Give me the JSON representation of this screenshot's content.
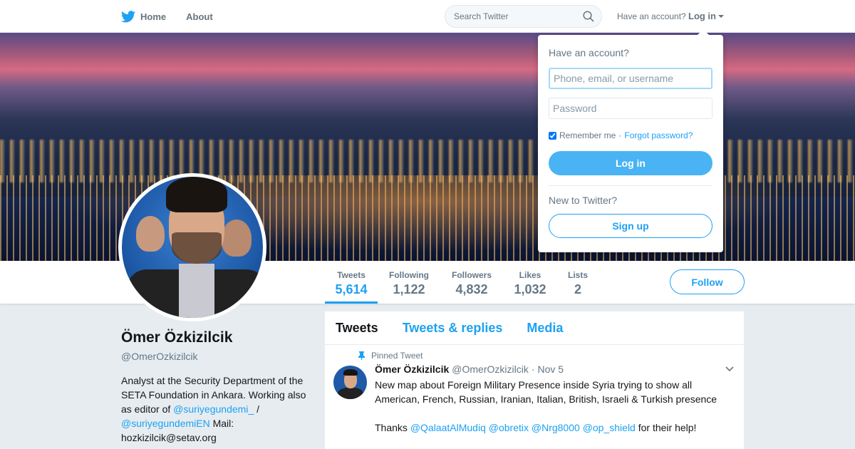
{
  "nav": {
    "home_label": "Home",
    "about_label": "About",
    "search_placeholder": "Search Twitter",
    "account_text": "Have an account?",
    "login_label": "Log in"
  },
  "stats": [
    {
      "label": "Tweets",
      "value": "5,614",
      "active": true
    },
    {
      "label": "Following",
      "value": "1,122"
    },
    {
      "label": "Followers",
      "value": "4,832"
    },
    {
      "label": "Likes",
      "value": "1,032"
    },
    {
      "label": "Lists",
      "value": "2"
    }
  ],
  "follow_label": "Follow",
  "profile": {
    "name": "Ömer Özkizilcik",
    "handle": "@OmerOzkizilcik",
    "bio_text_1": "Analyst at the Security Department of the SETA Foundation in Ankara. Working also as editor of ",
    "bio_link_1": "@suriyegundemi_",
    "bio_sep": " / ",
    "bio_link_2": "@suriyegundemiEN",
    "bio_text_2": " Mail: hozkizilcik@setav.org"
  },
  "timeline": {
    "tabs": [
      "Tweets",
      "Tweets & replies",
      "Media"
    ],
    "pinned_label": "Pinned Tweet",
    "tweet": {
      "name": "Ömer Özkizilcik",
      "handle": "@OmerOzkizilcik",
      "separator": "·",
      "date": "Nov 5",
      "body": "New map about Foreign Military Presence inside Syria trying to show all American, French, Russian, Iranian, Italian, British, Israeli & Turkish presence",
      "thanks_prefix": "Thanks ",
      "mentions": [
        "@QalaatAlMudiq",
        "@obretix",
        "@Nrg8000",
        "@op_shield"
      ],
      "thanks_suffix": " for their help!"
    }
  },
  "login_dropdown": {
    "title": "Have an account?",
    "username_placeholder": "Phone, email, or username",
    "password_placeholder": "Password",
    "remember_label": "Remember me",
    "remember_checked": true,
    "dot": "·",
    "forgot_label": "Forgot password?",
    "login_button": "Log in",
    "new_text": "New to Twitter?",
    "signup_button": "Sign up"
  },
  "colors": {
    "accent": "#1da1f2",
    "login_button_bg": "#4ab3f4",
    "page_bg": "#e6ecf0"
  }
}
